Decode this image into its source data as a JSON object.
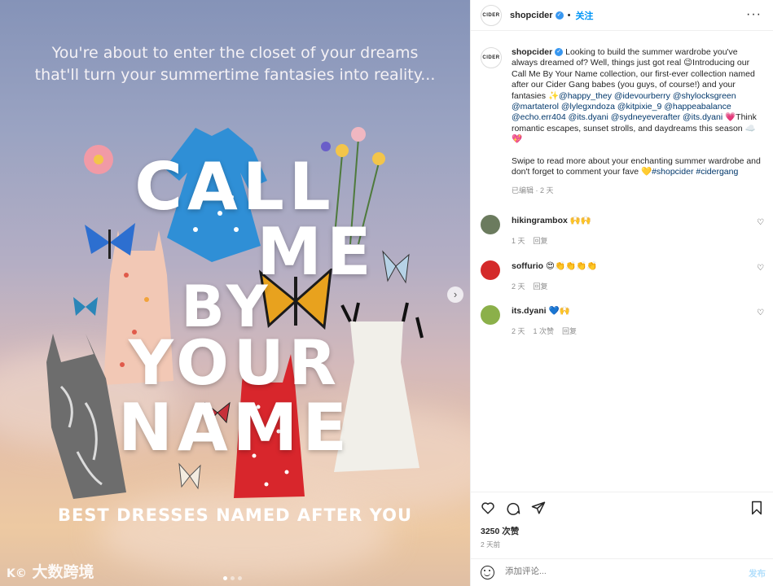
{
  "image": {
    "intro_line1": "You're about to enter the closet of your dreams",
    "intro_line2": "that'll turn your summertime fantasies into reality...",
    "title_words": [
      "CALL",
      "ME",
      "BY",
      "YOUR",
      "NAME"
    ],
    "tagline": "BEST DRESSES NAMED AFTER YOU",
    "watermark": "大数跨境",
    "next_arrow": "›"
  },
  "header": {
    "logo_text": "CIDER",
    "username": "shopcider",
    "separator": "•",
    "follow_label": "关注",
    "more_label": "···"
  },
  "caption": {
    "username": "shopcider",
    "text_before_tags": " Looking to build the summer wardrobe you've always dreamed of? Well, things just got real 😉Introducing our Call Me By Your Name collection, our first-ever collection named after our Cider Gang babes (you guys, of course!) and your fantasies ✨",
    "mentions": "@happy_they @idevourberry @shylocksgreen @martaterol @lylegxndoza @kitpixie_9 @happeabalance @echo.err404 @its.dyani @sydneyeverafter @its.dyani",
    "text_after_tags": " 💗Think romantic escapes, sunset strolls, and daydreams this season ☁️💖\n\nSwipe to read more about your enchanting summer wardrobe and don't forget to comment your fave 💛",
    "hashtags": "#shopcider #cidergang",
    "meta": "已编辑 · 2 天"
  },
  "comments": [
    {
      "username": "hikingrambox",
      "text": "🙌🙌",
      "time": "1 天",
      "likes": "",
      "reply": "回复",
      "avatar_color": "#6b7b5e"
    },
    {
      "username": "soffurio",
      "text": "😍👏👏👏👏",
      "time": "2 天",
      "likes": "",
      "reply": "回复",
      "avatar_color": "#d42a2a"
    },
    {
      "username": "its.dyani",
      "text": "💙🙌",
      "time": "2 天",
      "likes": "1 次赞",
      "reply": "回复",
      "avatar_color": "#8bb04a"
    }
  ],
  "actions": {
    "likes": "3250 次赞",
    "ago": "2 天前",
    "comment_placeholder": "添加评论...",
    "post_label": "发布"
  }
}
